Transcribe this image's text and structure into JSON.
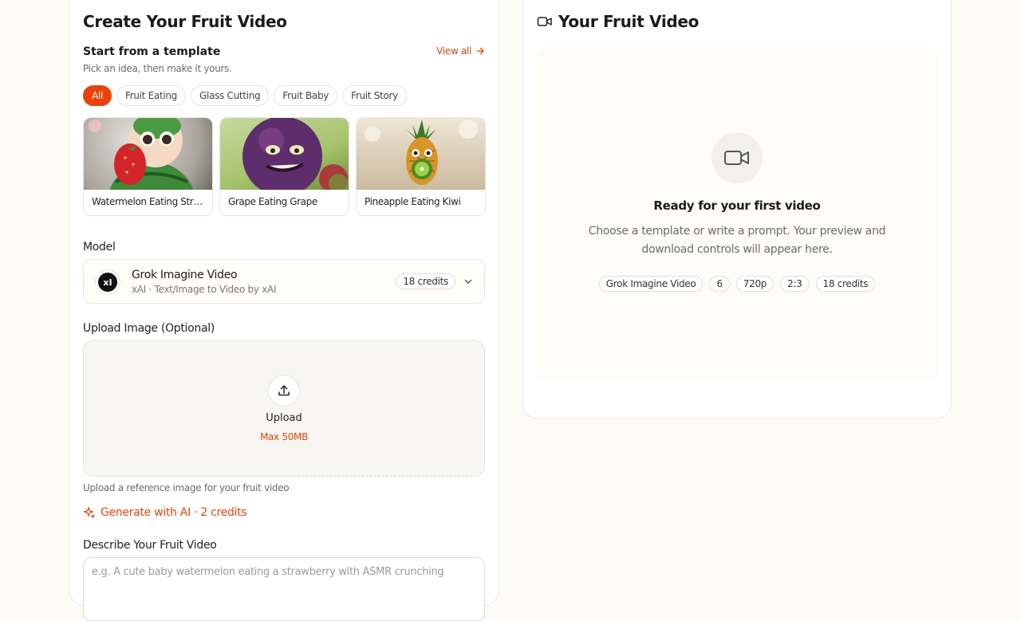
{
  "left": {
    "title": "Create Your Fruit Video",
    "templates": {
      "heading": "Start from a template",
      "subheading": "Pick an idea, then make it yours.",
      "view_all": "View all",
      "filters": [
        "All",
        "Fruit Eating",
        "Glass Cutting",
        "Fruit Baby",
        "Fruit Story"
      ],
      "active_filter": "All",
      "cards": [
        {
          "label": "Watermelon Eating Str…"
        },
        {
          "label": "Grape Eating Grape"
        },
        {
          "label": "Pineapple Eating Kiwi"
        }
      ]
    },
    "model": {
      "label": "Model",
      "name": "Grok Imagine Video",
      "description": "xAI · Text/Image to Video by xAI",
      "credits": "18 credits",
      "logo_text": "xI"
    },
    "upload": {
      "label": "Upload Image (Optional)",
      "button": "Upload",
      "max": "Max 50MB",
      "help": "Upload a reference image for your fruit video"
    },
    "generate_ai": "Generate with AI · 2 credits",
    "describe": {
      "label": "Describe Your Fruit Video",
      "placeholder": "e.g. A cute baby watermelon eating a strawberry with ASMR crunching"
    }
  },
  "right": {
    "title": "Your Fruit Video",
    "empty_title": "Ready for your first video",
    "empty_text": "Choose a template or write a prompt. Your preview and download controls will appear here.",
    "tags": [
      "Grok Imagine Video",
      "6",
      "720p",
      "2:3",
      "18 credits"
    ]
  },
  "colors": {
    "accent": "#e8420c",
    "accent_text": "#d9480f",
    "background": "#fcfbf6",
    "panel": "#ffffff"
  },
  "icons": [
    "arrow-right-icon",
    "chevron-down-icon",
    "upload-icon",
    "sparkle-icon",
    "video-camera-icon"
  ]
}
